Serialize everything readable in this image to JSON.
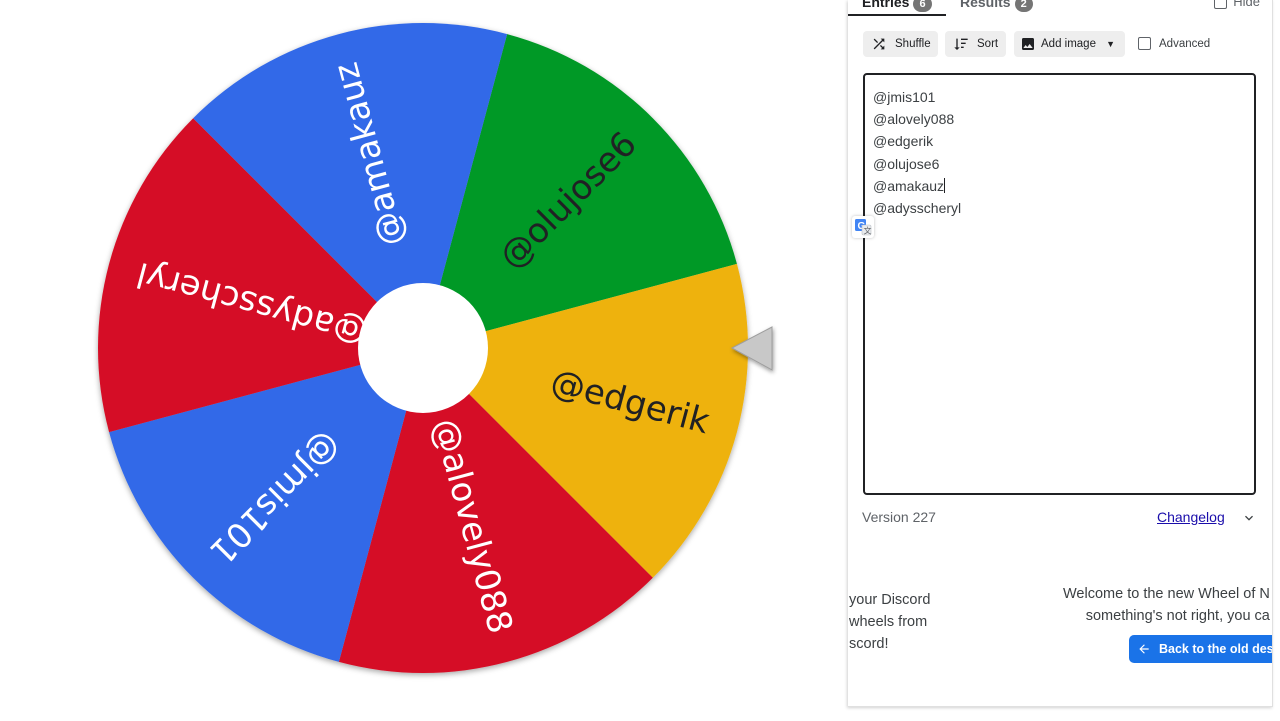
{
  "tabs": [
    {
      "label": "Entries",
      "count": "6"
    },
    {
      "label": "Results",
      "count": "2"
    }
  ],
  "hide_label": "Hide",
  "toolbar": {
    "shuffle_label": "Shuffle",
    "sort_label": "Sort",
    "add_image_label": "Add image",
    "advanced_label": "Advanced"
  },
  "entries": [
    "@jmis101",
    "@alovely088",
    "@edgerik",
    "@olujose6",
    "@amakauz",
    "@adysscheryl"
  ],
  "wheel": {
    "segments": [
      {
        "label": "@olujose6",
        "color": "#009925",
        "text_color": "#202124"
      },
      {
        "label": "@edgerik",
        "color": "#EEB211",
        "text_color": "#202124"
      },
      {
        "label": "@alovely088",
        "color": "#D50F25",
        "text_color": "#ffffff"
      },
      {
        "label": "@jmis101",
        "color": "#3369E8",
        "text_color": "#ffffff"
      },
      {
        "label": "@adysscheryl",
        "color": "#D50F25",
        "text_color": "#ffffff"
      },
      {
        "label": "@amakauz",
        "color": "#3369E8",
        "text_color": "#ffffff"
      }
    ]
  },
  "footer": {
    "version": "Version 227",
    "changelog": "Changelog"
  },
  "promo": {
    "left_lines": [
      "your Discord",
      " wheels from",
      "scord!"
    ],
    "right_lines": [
      "Welcome to the new Wheel of N",
      "something's not right, you ca"
    ],
    "back_button": "Back to the old desi"
  }
}
